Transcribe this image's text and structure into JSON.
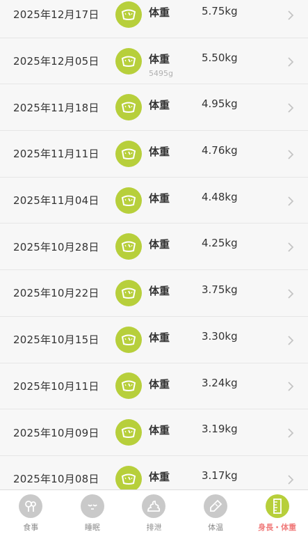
{
  "records": [
    {
      "date": "2025年12月17日",
      "type": "体重",
      "value": "5.75kg",
      "sub": ""
    },
    {
      "date": "2025年12月05日",
      "type": "体重",
      "value": "5.50kg",
      "sub": "5495g"
    },
    {
      "date": "2025年11月18日",
      "type": "体重",
      "value": "4.95kg",
      "sub": ""
    },
    {
      "date": "2025年11月11日",
      "type": "体重",
      "value": "4.76kg",
      "sub": ""
    },
    {
      "date": "2025年11月04日",
      "type": "体重",
      "value": "4.48kg",
      "sub": ""
    },
    {
      "date": "2025年10月28日",
      "type": "体重",
      "value": "4.25kg",
      "sub": ""
    },
    {
      "date": "2025年10月22日",
      "type": "体重",
      "value": "3.75kg",
      "sub": ""
    },
    {
      "date": "2025年10月15日",
      "type": "体重",
      "value": "3.30kg",
      "sub": ""
    },
    {
      "date": "2025年10月11日",
      "type": "体重",
      "value": "3.24kg",
      "sub": ""
    },
    {
      "date": "2025年10月09日",
      "type": "体重",
      "value": "3.19kg",
      "sub": ""
    },
    {
      "date": "2025年10月08日",
      "type": "体重",
      "value": "3.17kg",
      "sub": ""
    }
  ],
  "tabs": [
    {
      "label": "食事",
      "icon": "meal-icon",
      "active": false
    },
    {
      "label": "睡眠",
      "icon": "sleep-icon",
      "active": false
    },
    {
      "label": "排泄",
      "icon": "poop-icon",
      "active": false
    },
    {
      "label": "体温",
      "icon": "thermometer-icon",
      "active": false
    },
    {
      "label": "身長・体重",
      "icon": "ruler-icon",
      "active": true
    }
  ],
  "colors": {
    "accent_green": "#b7cf3b",
    "active_tab_text": "#f07b7b",
    "top_bar": "#f08a8a"
  }
}
